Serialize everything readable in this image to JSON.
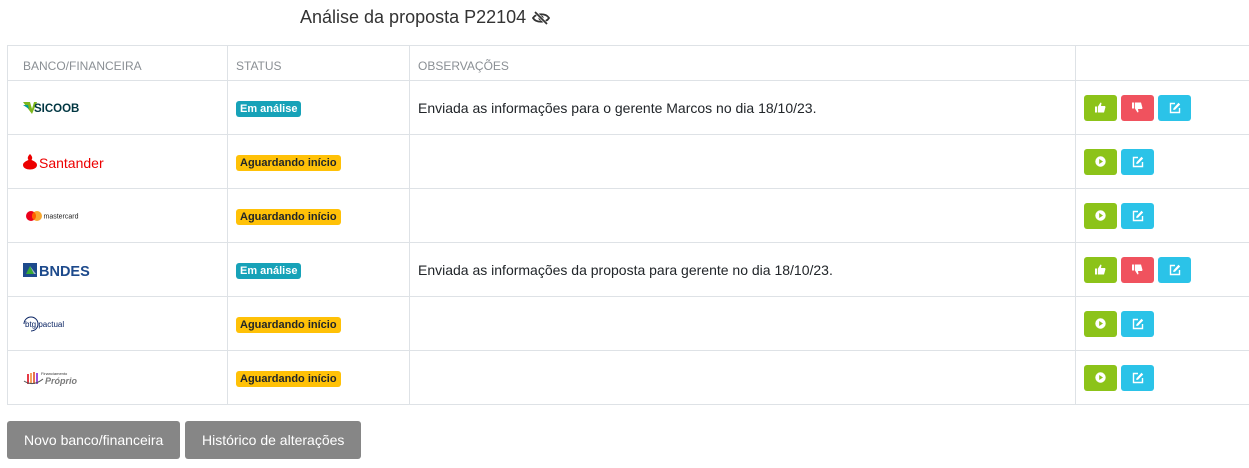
{
  "page": {
    "title": "Análise da proposta P22104",
    "title_icon": "eye-slash-icon"
  },
  "table": {
    "headers": [
      "BANCO/FINANCEIRA",
      "STATUS",
      "OBSERVAÇÕES",
      ""
    ],
    "rows": [
      {
        "bank": "SICOOB",
        "logo": "sicoob-logo",
        "status": "Em análise",
        "status_type": "info",
        "observation": "Enviada as informações para o gerente Marcos no dia 18/10/23.",
        "actions": [
          "approve",
          "reject",
          "edit"
        ]
      },
      {
        "bank": "Santander",
        "logo": "santander-logo",
        "status": "Aguardando início",
        "status_type": "warning",
        "observation": "",
        "actions": [
          "start",
          "edit"
        ]
      },
      {
        "bank": "mastercard",
        "logo": "mastercard-logo",
        "status": "Aguardando início",
        "status_type": "warning",
        "observation": "",
        "actions": [
          "start",
          "edit"
        ]
      },
      {
        "bank": "BNDES",
        "logo": "bndes-logo",
        "status": "Em análise",
        "status_type": "info",
        "observation": "Enviada as informações da proposta para gerente no dia 18/10/23.",
        "actions": [
          "approve",
          "reject",
          "edit"
        ]
      },
      {
        "bank": "btg pactual",
        "logo": "btg-pactual-logo",
        "status": "Aguardando início",
        "status_type": "warning",
        "observation": "",
        "actions": [
          "start",
          "edit"
        ]
      },
      {
        "bank": "Financiamento Próprio",
        "bank_small": "Financiamento",
        "bank_large": "Próprio",
        "logo": "financiamento-proprio-logo",
        "status": "Aguardando início",
        "status_type": "warning",
        "observation": "",
        "actions": [
          "start",
          "edit"
        ]
      }
    ]
  },
  "buttons": {
    "new_bank": "Novo banco/financeira",
    "history": "Histórico de alterações"
  },
  "colors": {
    "approve": "#8cc319",
    "reject": "#f0525e",
    "edit": "#2bc3e8",
    "status_info": "#17a2b8",
    "status_warning": "#ffc107",
    "button_gray": "#868686",
    "sicoob": "#003641",
    "santander": "#ec0000",
    "bndes": "#1d4a8c"
  }
}
